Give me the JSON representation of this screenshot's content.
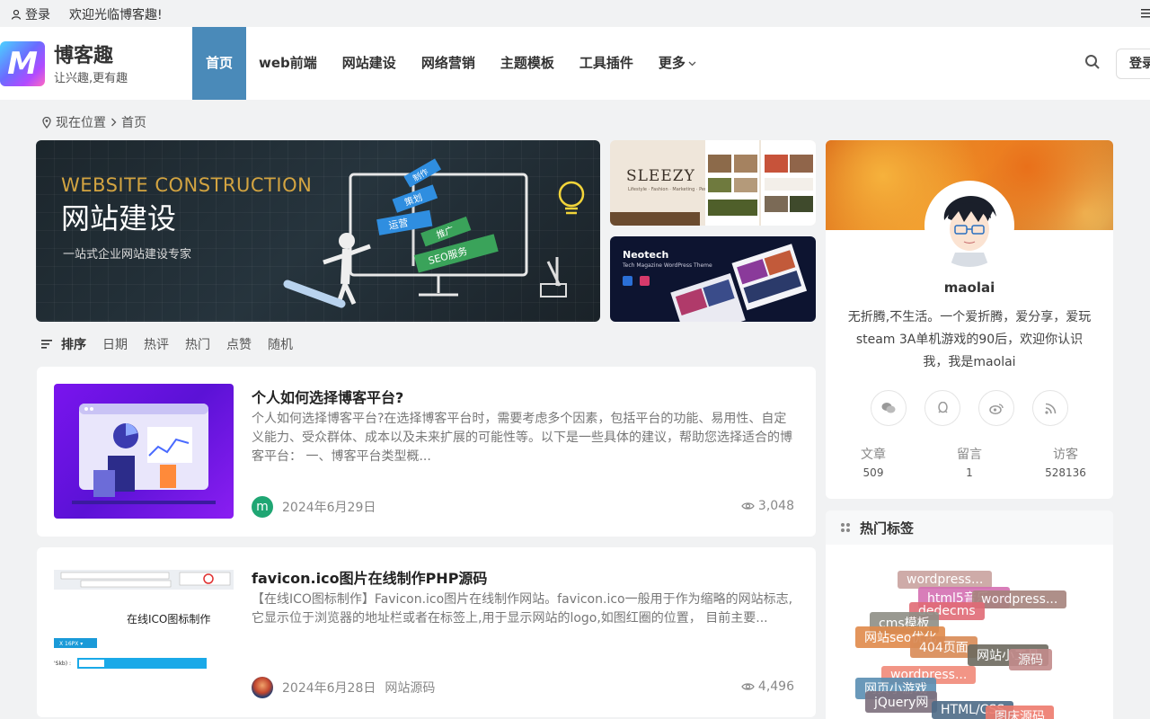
{
  "topbar": {
    "login": "登录",
    "welcome": "欢迎光临博客趣!"
  },
  "header": {
    "logo_letter": "M",
    "site_name": "博客趣",
    "slogan": "让兴趣,更有趣",
    "nav": [
      {
        "label": "首页",
        "active": true
      },
      {
        "label": "web前端"
      },
      {
        "label": "网站建设"
      },
      {
        "label": "网络营销"
      },
      {
        "label": "主题模板"
      },
      {
        "label": "工具插件"
      },
      {
        "label": "更多"
      }
    ],
    "login_button": "登录"
  },
  "breadcrumb": {
    "prefix": "现在位置",
    "current": "首页"
  },
  "banners": {
    "main": {
      "en": "WEBSITE CONSTRUCTION",
      "cn": "网站建设",
      "sub": "一站式企业网站建设专家",
      "signs": [
        "制作",
        "策划",
        "运营",
        "推广",
        "SEO服务"
      ]
    },
    "small1": {
      "title": "SLEEZY",
      "sub": "Lifestyle · Fashion · Marketing · Personal"
    },
    "small2": {
      "title": "Neotech",
      "sub": "Tech Magazine WordPress Theme"
    }
  },
  "sortbar": {
    "items": [
      "排序",
      "日期",
      "热评",
      "热门",
      "点赞",
      "随机"
    ]
  },
  "posts": [
    {
      "title": "个人如何选择博客平台?",
      "excerpt": "个人如何选择博客平台?在选择博客平台时，需要考虑多个因素，包括平台的功能、易用性、自定义能力、受众群体、成本以及未来扩展的可能性等。以下是一些具体的建议，帮助您选择适合的博客平台： 一、博客平台类型概...",
      "author_initial": "m",
      "date": "2024年6月29日",
      "category": "",
      "views": "3,048"
    },
    {
      "title": "favicon.ico图片在线制作PHP源码",
      "excerpt": "【在线ICO图标制作】Favicon.ico图片在线制作网站。favicon.ico一般用于作为缩略的网站标志,它显示位于浏览器的地址栏或者在标签上,用于显示网站的logo,如图红圈的位置， 目前主要...",
      "thumb_label": "在线ICO图标制作",
      "date": "2024年6月28日",
      "category": "网站源码",
      "views": "4,496"
    }
  ],
  "profile": {
    "name": "maolai",
    "bio": "无折腾,不生活。一个爱折腾，爱分享，爱玩steam 3A单机游戏的90后，欢迎你认识我，我是maolai",
    "socials": [
      "wechat-icon",
      "qq-icon",
      "weibo-icon",
      "rss-icon"
    ],
    "stats": [
      {
        "label": "文章",
        "value": "509"
      },
      {
        "label": "留言",
        "value": "1"
      },
      {
        "label": "访客",
        "value": "528136"
      }
    ]
  },
  "hot_tags": {
    "title": "热门标签",
    "tags": [
      {
        "label": "wordpress...",
        "color": "#c9a39f"
      },
      {
        "label": "html5音乐...",
        "color": "#d46fb2"
      },
      {
        "label": "wordpress...",
        "color": "#a6837d"
      },
      {
        "label": "dedecms",
        "color": "#e16b76"
      },
      {
        "label": "cms模板",
        "color": "#8f8e86"
      },
      {
        "label": "网站seo优化",
        "color": "#e08a4b"
      },
      {
        "label": "404页面",
        "color": "#d98a55"
      },
      {
        "label": "网站小工具",
        "color": "#6d6a5f"
      },
      {
        "label": "源码",
        "color": "#c38b8b"
      },
      {
        "label": "wordpress...",
        "color": "#f18a7a"
      },
      {
        "label": "网页小游戏",
        "color": "#5a8fb3"
      },
      {
        "label": "jQuery网",
        "color": "#7d6f7d"
      },
      {
        "label": "HTML/CSS",
        "color": "#4d6b87"
      },
      {
        "label": "图床源码",
        "color": "#ee7b6d"
      }
    ]
  }
}
